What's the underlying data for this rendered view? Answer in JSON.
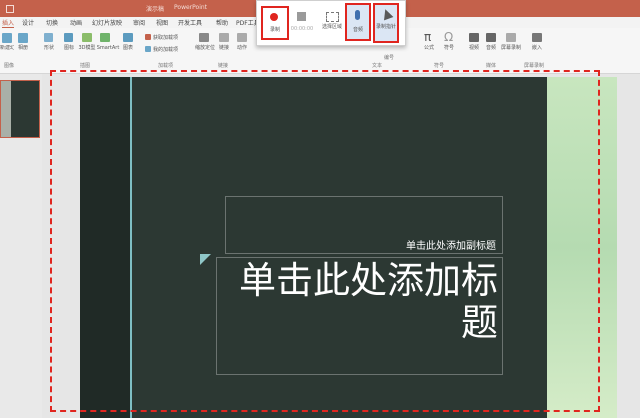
{
  "window": {
    "doc_name": "演示稿",
    "app_name": "PowerPoint"
  },
  "tabs": [
    "插入",
    "设计",
    "切换",
    "动画",
    "幻灯片放映",
    "审阅",
    "视图",
    "开发工具",
    "帮助",
    "PDF工具"
  ],
  "ribbon": {
    "buttons": [
      "新建幻灯片",
      "相册",
      "形状",
      "图标",
      "3D模型",
      "SmartArt",
      "图表",
      "获取加载项",
      "我的加载项",
      "缩放定位",
      "链接",
      "动作",
      "公式",
      "符号",
      "视频",
      "音频",
      "屏幕录制",
      "嵌入"
    ],
    "groups": [
      "图像",
      "插图",
      "加载项",
      "链接",
      "文本",
      "编号",
      "符号",
      "媒体",
      "屏幕录制"
    ]
  },
  "recording_toolbar": {
    "record_label": "录制",
    "timer": "00:00:00",
    "select_area_label": "选择区域",
    "audio_label": "音频",
    "pointer_label": "录制指针"
  },
  "slide": {
    "subtitle": "单击此处添加副标题",
    "title": "单击此处添加标题"
  },
  "colors": {
    "title_bar": "#c4614b",
    "slide_background": "#2c3833",
    "highlight": "#e0251f"
  }
}
